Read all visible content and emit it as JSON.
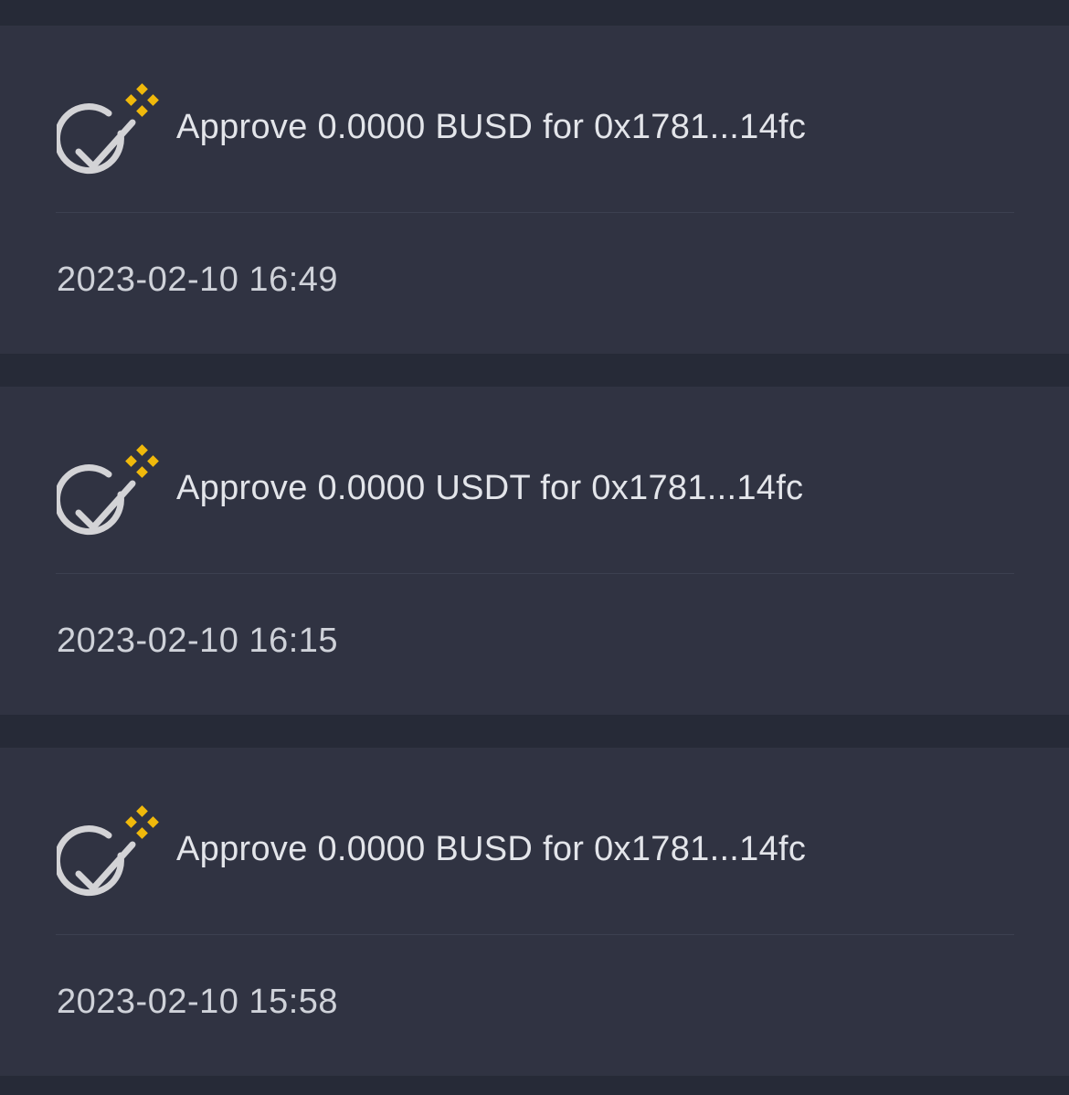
{
  "transactions": [
    {
      "icon": "approve-check-icon",
      "title": "Approve 0.0000 BUSD for 0x1781...14fc",
      "time": "2023-02-10 16:49"
    },
    {
      "icon": "approve-check-icon",
      "title": "Approve 0.0000 USDT for 0x1781...14fc",
      "time": "2023-02-10 16:15"
    },
    {
      "icon": "approve-check-icon",
      "title": "Approve 0.0000 BUSD for 0x1781...14fc",
      "time": "2023-02-10 15:58"
    }
  ],
  "colors": {
    "background": "#262a37",
    "card": "#303342",
    "text": "#e3e5ea",
    "icon_gray": "#d3d3d6",
    "accent_yellow": "#f0b90b"
  }
}
